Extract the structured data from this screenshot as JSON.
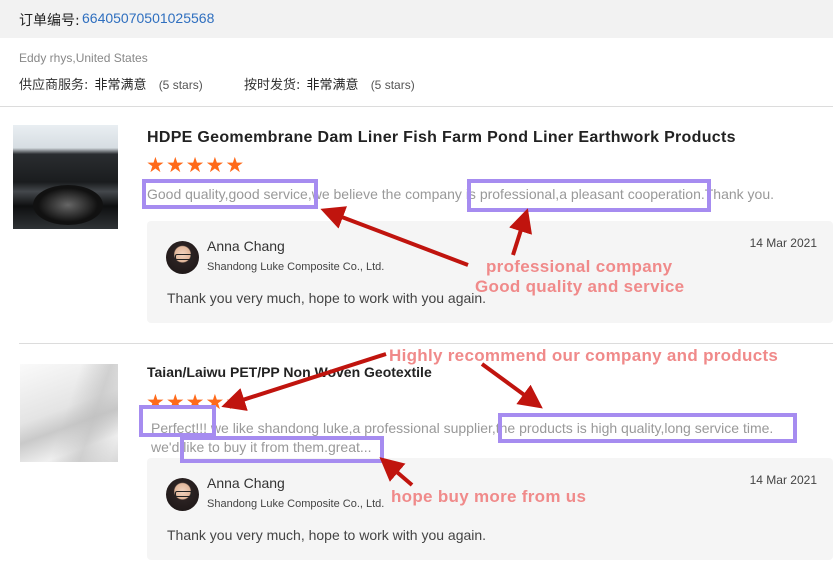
{
  "order": {
    "label": "订单编号:",
    "number": "66405070501025568"
  },
  "buyer": "Eddy rhys,United States",
  "ratings": [
    {
      "label": "供应商服务:",
      "value": "非常满意",
      "stars_text": "(5 stars)"
    },
    {
      "label": "按时发货:",
      "value": "非常满意",
      "stars_text": "(5 stars)"
    }
  ],
  "reviews": [
    {
      "product": "HDPE Geomembrane Dam Liner Fish Farm Pond Liner Earthwork Products",
      "stars": 5,
      "text": "Good quality,good service,we believe the company is professional,a pleasant cooperation.Thank you.",
      "reply": {
        "name": "Anna Chang",
        "company": "Shandong Luke Composite Co., Ltd.",
        "date": "14 Mar 2021",
        "text": "Thank you very much, hope to work with you again."
      }
    },
    {
      "product": "Taian/Laiwu PET/PP Non Woven Geotextile",
      "stars": 5,
      "text_line1": "Perfect!!! we like shandong luke,a professional supplier,the products is high quality,long service time.",
      "text_line2": "we'd like to buy it from them.great...",
      "reply": {
        "name": "Anna Chang",
        "company": "Shandong Luke Composite Co., Ltd.",
        "date": "14 Mar 2021",
        "text": "Thank you very much, hope to work with you again."
      }
    }
  ],
  "annotations": {
    "a1": "professional company",
    "a2": "Good quality and service",
    "a3": "Highly recommend our company and products",
    "a4": "hope buy more from us"
  },
  "colors": {
    "star": "#ff6a1a",
    "highlight": "#a68cf0",
    "arrow": "#c0140e",
    "annotation": "#f08a8a",
    "link": "#2f6fbf"
  }
}
